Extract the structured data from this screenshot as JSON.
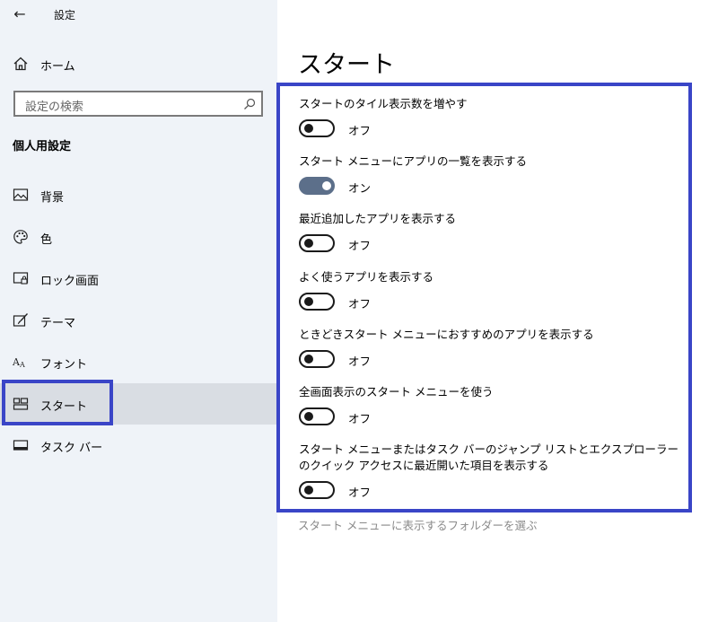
{
  "app": {
    "title": "設定",
    "back_glyph": "←"
  },
  "sidebar": {
    "home_label": "ホーム",
    "search_placeholder": "設定の検索",
    "section_title": "個人用設定",
    "items": [
      {
        "label": "背景",
        "icon": "picture-icon"
      },
      {
        "label": "色",
        "icon": "palette-icon"
      },
      {
        "label": "ロック画面",
        "icon": "lock-screen-icon"
      },
      {
        "label": "テーマ",
        "icon": "theme-brush-icon"
      },
      {
        "label": "フォント",
        "icon": "font-icon"
      },
      {
        "label": "スタート",
        "icon": "start-tiles-icon",
        "selected": true
      },
      {
        "label": "タスク バー",
        "icon": "taskbar-icon"
      }
    ]
  },
  "main": {
    "title": "スタート",
    "settings": [
      {
        "label": "スタートのタイル表示数を増やす",
        "state": "オフ",
        "on": false
      },
      {
        "label": "スタート メニューにアプリの一覧を表示する",
        "state": "オン",
        "on": true
      },
      {
        "label": "最近追加したアプリを表示する",
        "state": "オフ",
        "on": false
      },
      {
        "label": "よく使うアプリを表示する",
        "state": "オフ",
        "on": false
      },
      {
        "label": "ときどきスタート メニューにおすすめのアプリを表示する",
        "state": "オフ",
        "on": false
      },
      {
        "label": "全画面表示のスタート メニューを使う",
        "state": "オフ",
        "on": false
      },
      {
        "label": "スタート メニューまたはタスク バーのジャンプ リストとエクスプローラーのクイック アクセスに最近開いた項目を表示する",
        "state": "オフ",
        "on": false
      }
    ],
    "link": "スタート メニューに表示するフォルダーを選ぶ"
  },
  "colors": {
    "sidebar_bg": "#eff3f8",
    "selected_bg": "#d9dde3",
    "highlight_border": "#3a45c7",
    "toggle_on": "#5c6f8a",
    "link": "#8a8a8a"
  }
}
